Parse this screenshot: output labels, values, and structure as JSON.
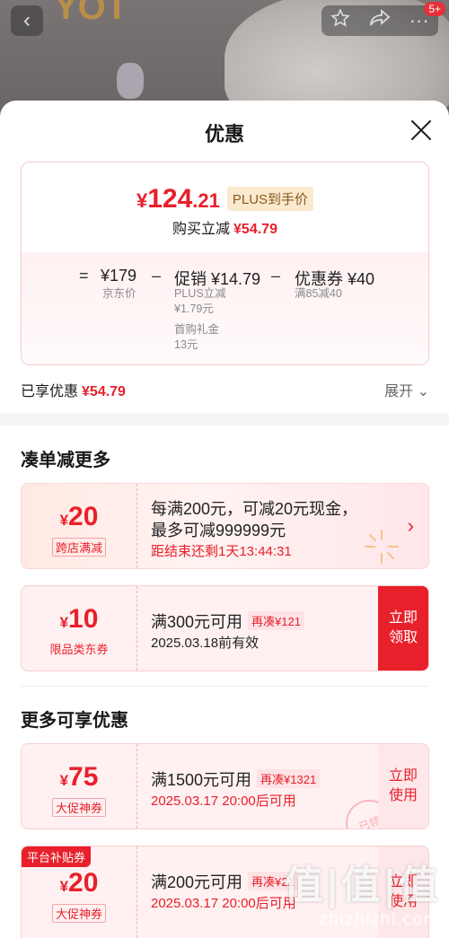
{
  "header": {
    "badge": "5+"
  },
  "sheet": {
    "title": "优惠",
    "price": {
      "yen": "¥",
      "int": "124",
      "dec": ".21",
      "plus_tag": "PLUS到手价",
      "buy_label": "购买立减",
      "buy_amount": "¥54.79"
    },
    "calc": {
      "eq": "=",
      "jd_price": "¥179",
      "jd_label": "京东价",
      "minus": "–",
      "promo_value": "促销 ¥14.79",
      "promo_sub1": "PLUS立减",
      "promo_sub2": "¥1.79元",
      "promo_sub3": "首购礼金",
      "promo_sub4": "13元",
      "coupon_value": "优惠券 ¥40",
      "coupon_sub": "满85减40"
    },
    "enjoyed": {
      "label": "已享优惠",
      "amount": "¥54.79",
      "expand": "展开"
    }
  },
  "section1": {
    "title": "凑单减更多",
    "coupons": [
      {
        "yen": "¥",
        "amount": "20",
        "tag": "跨店满减",
        "line1": "每满200元，可减20元现金，",
        "line1b": "最多可减999999元",
        "line2": "距结束还剩1天13:44:31"
      },
      {
        "yen": "¥",
        "amount": "10",
        "tag": "限品类东券",
        "line1": "满300元可用",
        "add": "再凑¥121",
        "line2": "2025.03.18前有效",
        "action1": "立即",
        "action2": "领取"
      }
    ]
  },
  "section2": {
    "title": "更多可享优惠",
    "coupons": [
      {
        "yen": "¥",
        "amount": "75",
        "tag": "大促神券",
        "line1": "满1500元可用",
        "add": "再凑¥1321",
        "line2": "2025.03.17 20:00后可用",
        "action1": "立即",
        "action2": "使用",
        "stamp": "已领"
      },
      {
        "ribbon": "平台补贴券",
        "yen": "¥",
        "amount": "20",
        "tag": "大促神券",
        "line1": "满200元可用",
        "add": "再凑¥21",
        "line2": "2025.03.17 20:00后可用",
        "action1": "立即",
        "action2": "使用"
      }
    ]
  },
  "watermark": {
    "big": "值|值|值",
    "small": "zhizhizhi.com"
  },
  "colors": {
    "accent": "#e8202b",
    "plus_bg": "#fbe9cf",
    "card_border": "#f7c9cd"
  }
}
